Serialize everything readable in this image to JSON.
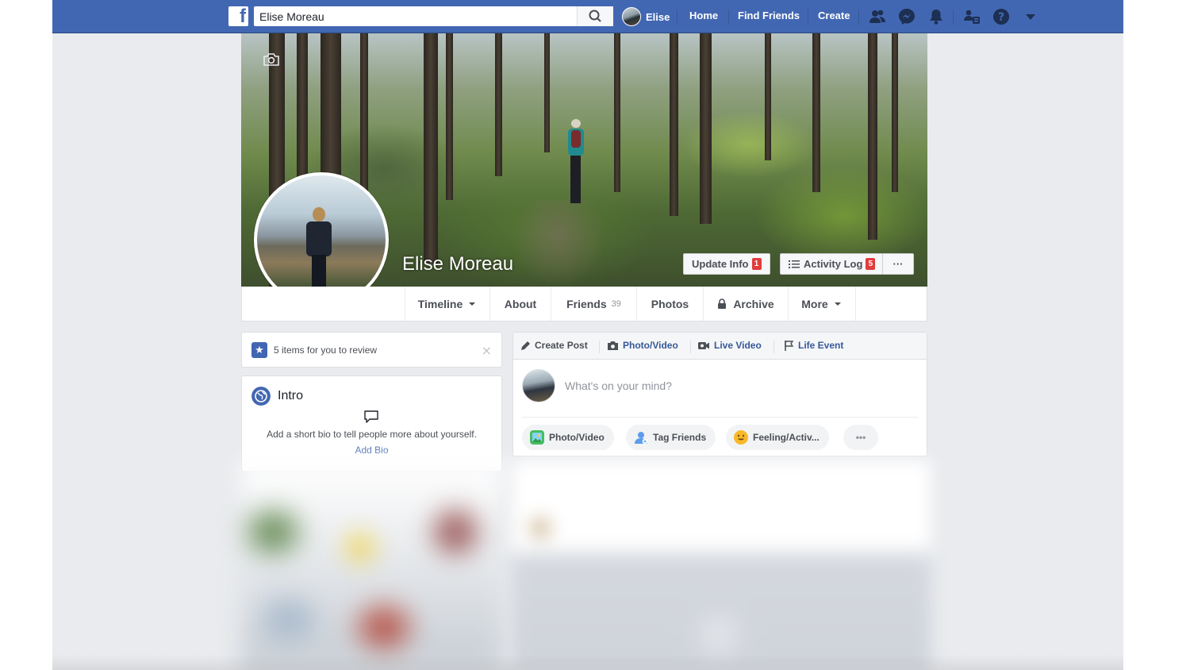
{
  "topbar": {
    "search_value": "Elise Moreau",
    "user_name": "Elise",
    "nav": {
      "home": "Home",
      "find_friends": "Find Friends",
      "create": "Create"
    },
    "icons": [
      "facebook-logo-icon",
      "search-icon",
      "friend-requests-icon",
      "messenger-icon",
      "notifications-icon",
      "quick-help-icon",
      "help-icon",
      "account-menu-icon"
    ],
    "color": "#4267b2"
  },
  "cover": {
    "camera_icon": "camera-icon",
    "profile_name": "Elise Moreau",
    "update_info": "Update Info",
    "update_info_badge": "1",
    "activity_log": "Activity Log",
    "activity_log_badge": "5",
    "more": "···"
  },
  "tabs": {
    "timeline": "Timeline",
    "about": "About",
    "friends": "Friends",
    "friends_count": "39",
    "photos": "Photos",
    "archive": "Archive",
    "more": "More"
  },
  "review": {
    "text": "5 items for you to review",
    "close": "×"
  },
  "intro": {
    "title": "Intro",
    "description": "Add a short bio to tell people more about yourself.",
    "add_bio": "Add Bio"
  },
  "composer": {
    "tabs": {
      "create_post": "Create Post",
      "photo_video": "Photo/Video",
      "live_video": "Live Video",
      "life_event": "Life Event"
    },
    "placeholder": "What's on your mind?",
    "actions": {
      "photo_video": "Photo/Video",
      "tag_friends": "Tag Friends",
      "feeling": "Feeling/Activ...",
      "more": "•••"
    }
  },
  "colors": {
    "brand": "#4267b2",
    "page_bg": "#e9ebee",
    "badge_red": "#e23c3c"
  }
}
